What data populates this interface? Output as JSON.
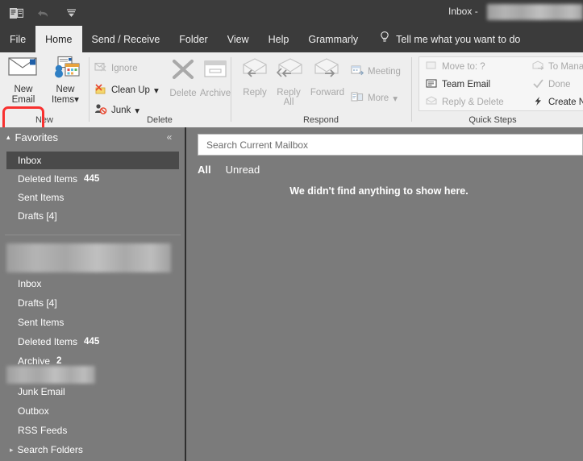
{
  "titlebar": {
    "window_title": "Inbox -",
    "redacted_account": "",
    "quick_access": [
      {
        "name": "outlook-icon",
        "glyph": "✉"
      },
      {
        "name": "undo-icon",
        "glyph": "↶"
      },
      {
        "name": "customize-qat-icon",
        "glyph": "▾"
      }
    ]
  },
  "tabs": [
    {
      "label": "File",
      "active": false
    },
    {
      "label": "Home",
      "active": true
    },
    {
      "label": "Send / Receive",
      "active": false
    },
    {
      "label": "Folder",
      "active": false
    },
    {
      "label": "View",
      "active": false
    },
    {
      "label": "Help",
      "active": false
    },
    {
      "label": "Grammarly",
      "active": false
    }
  ],
  "tellme": {
    "label": "Tell me what you want to do",
    "icon": "lightbulb-icon"
  },
  "ribbon": {
    "groups": [
      {
        "id": "new",
        "label": "New"
      },
      {
        "id": "delete",
        "label": "Delete"
      },
      {
        "id": "respond",
        "label": "Respond"
      },
      {
        "id": "quicksteps",
        "label": "Quick Steps"
      }
    ],
    "new_group": {
      "new_email": {
        "line1": "New",
        "line2": "Email",
        "highlighted": true
      },
      "new_items": {
        "line1": "New",
        "line2": "Items",
        "caret": "▾"
      }
    },
    "delete_group": {
      "ignore": "Ignore",
      "clean_up": "Clean Up",
      "clean_up_caret": "▾",
      "junk": "Junk",
      "junk_caret": "▾",
      "delete": "Delete",
      "archive": "Archive"
    },
    "respond_group": {
      "reply": "Reply",
      "reply_all_line1": "Reply",
      "reply_all_line2": "All",
      "forward": "Forward",
      "meeting": "Meeting",
      "more": "More",
      "more_caret": "▾"
    },
    "quick_steps": {
      "move_to": "Move to: ?",
      "team_email": "Team Email",
      "reply_delete": "Reply & Delete",
      "to_manager": "To Manager",
      "done": "Done",
      "create_new": "Create New"
    }
  },
  "sidebar": {
    "favorites_header": "Favorites",
    "favorites_caret": "▴",
    "collapse_icon": "«",
    "favorites": [
      {
        "label": "Inbox",
        "count": "",
        "selected": true
      },
      {
        "label": "Deleted Items",
        "count": "445",
        "selected": false
      },
      {
        "label": "Sent Items",
        "count": "",
        "selected": false
      },
      {
        "label": "Drafts [4]",
        "count": "",
        "selected": false
      }
    ],
    "account_folders": [
      {
        "label": "Inbox",
        "count": ""
      },
      {
        "label": "Drafts [4]",
        "count": ""
      },
      {
        "label": "Sent Items",
        "count": ""
      },
      {
        "label": "Deleted Items",
        "count": "445"
      },
      {
        "label": "Archive",
        "count": "2"
      }
    ],
    "sub_folders": [
      {
        "label": "Junk Email",
        "count": ""
      },
      {
        "label": "Outbox",
        "count": ""
      },
      {
        "label": "RSS Feeds",
        "count": ""
      }
    ],
    "search_folders": {
      "label": "Search Folders",
      "caret": "▸"
    }
  },
  "main": {
    "search": {
      "placeholder": "Search Current Mailbox",
      "value": ""
    },
    "filters": [
      {
        "label": "All",
        "active": true
      },
      {
        "label": "Unread",
        "active": false
      }
    ],
    "empty_message": "We didn't find anything to show here."
  },
  "colors": {
    "chrome_dark": "#3b3b3b",
    "ribbon_bg": "#eeeeee",
    "app_gray": "#7b7b7b",
    "selection": "#4a4a4a",
    "highlight_red": "#f8302f"
  }
}
